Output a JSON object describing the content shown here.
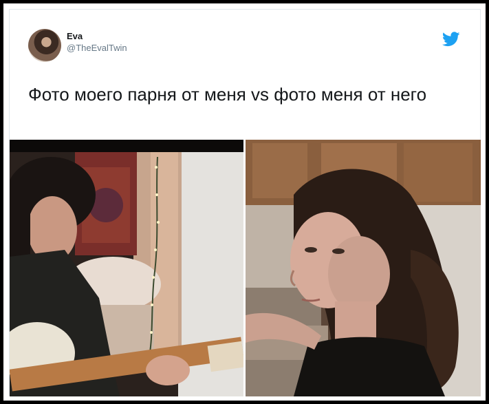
{
  "author": {
    "name": "Eva",
    "handle": "@TheEvalTwin"
  },
  "tweet": {
    "text": "Фото моего парня от меня vs фото меня от него"
  },
  "icons": {
    "brand": "twitter-bird-icon",
    "brand_color": "#1da1f2"
  }
}
